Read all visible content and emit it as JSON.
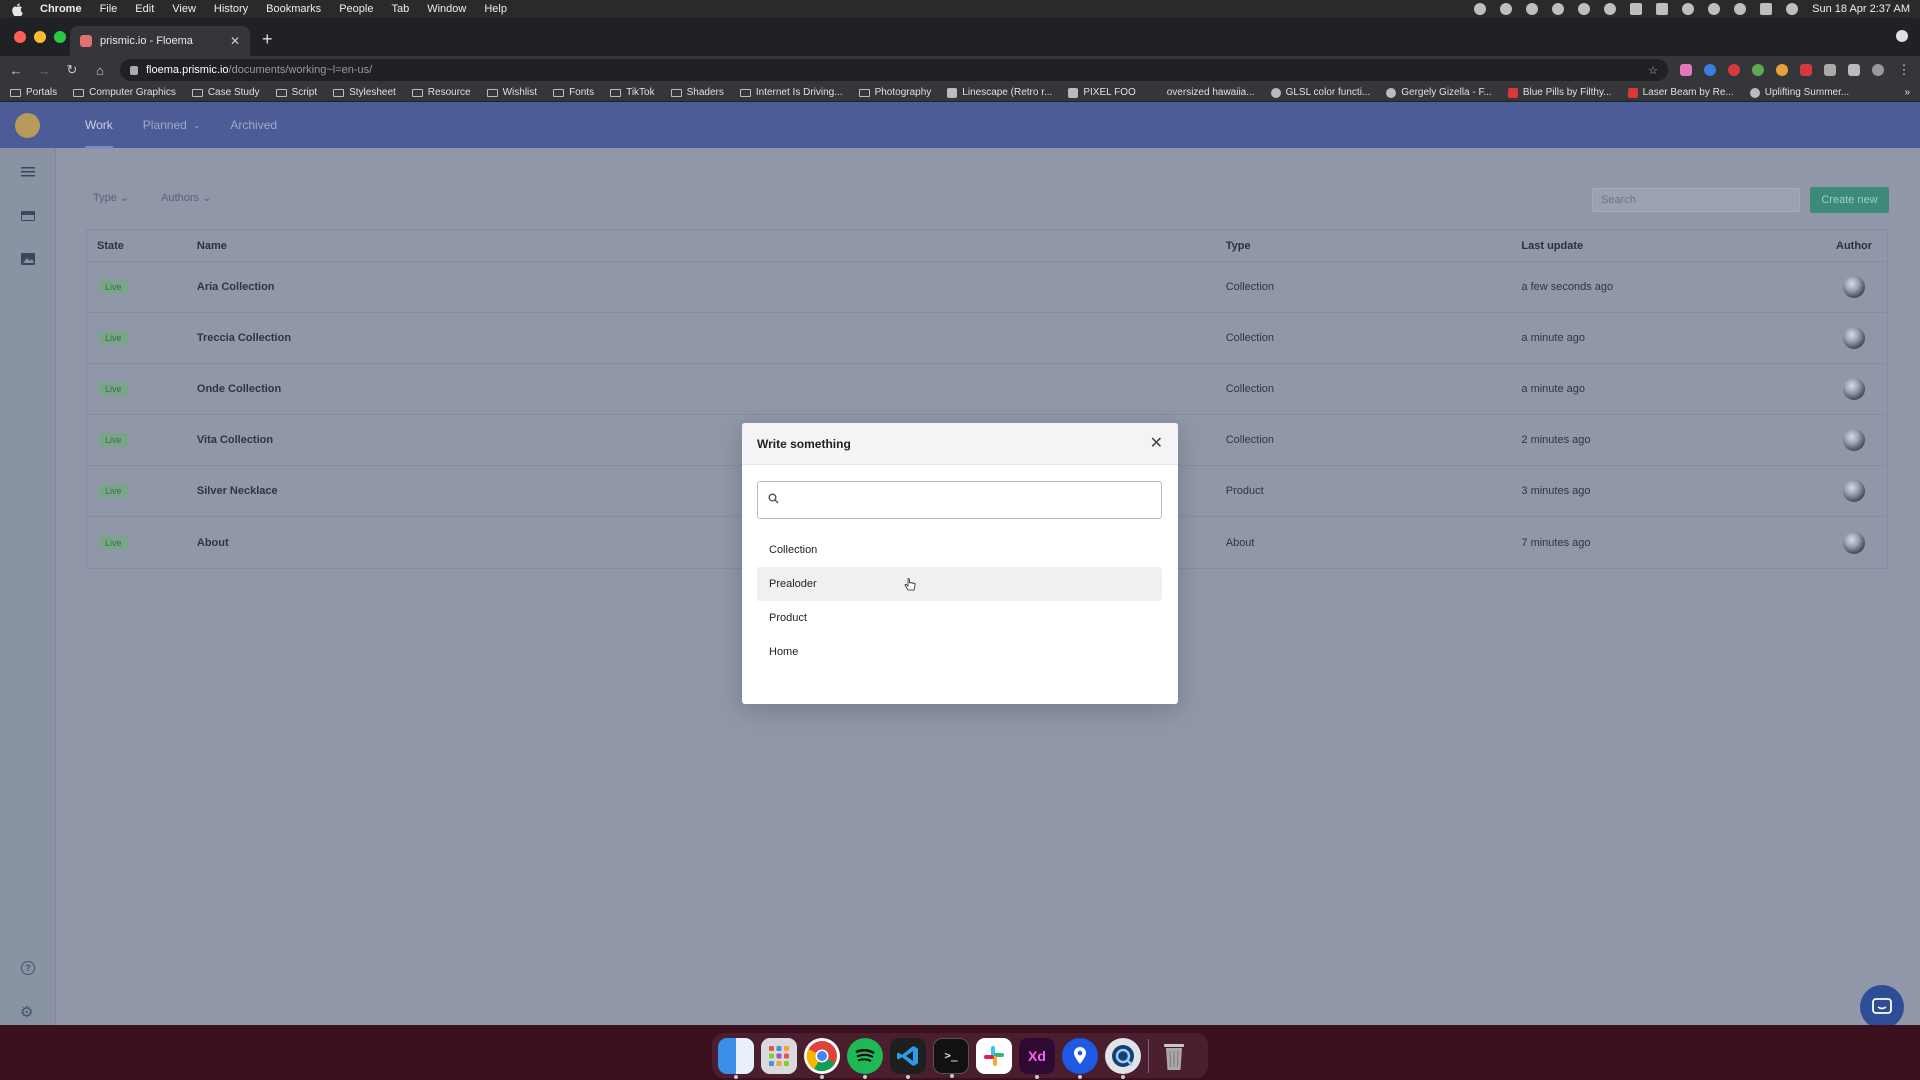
{
  "menubar": {
    "app_name": "Chrome",
    "items": [
      "File",
      "Edit",
      "View",
      "History",
      "Bookmarks",
      "People",
      "Tab",
      "Window",
      "Help"
    ],
    "clock": "Sun 18 Apr  2:37 AM"
  },
  "browser": {
    "tab_title": "prismic.io - Floema",
    "url_host": "floema.prismic.io",
    "url_path": "/documents/working~l=en-us/",
    "bookmarks": [
      {
        "label": "Portals",
        "icon": "folder-icon"
      },
      {
        "label": "Computer Graphics",
        "icon": "folder-icon"
      },
      {
        "label": "Case Study",
        "icon": "folder-icon"
      },
      {
        "label": "Script",
        "icon": "folder-icon"
      },
      {
        "label": "Stylesheet",
        "icon": "folder-icon"
      },
      {
        "label": "Resource",
        "icon": "folder-icon"
      },
      {
        "label": "Wishlist",
        "icon": "folder-icon"
      },
      {
        "label": "Fonts",
        "icon": "folder-icon"
      },
      {
        "label": "TikTok",
        "icon": "folder-icon"
      },
      {
        "label": "Shaders",
        "icon": "folder-icon"
      },
      {
        "label": "Internet Is Driving...",
        "icon": "folder-icon"
      },
      {
        "label": "Photography",
        "icon": "folder-icon"
      },
      {
        "label": "Linescape (Retro r...",
        "icon": "favicon"
      },
      {
        "label": "PIXEL FOO",
        "icon": "favicon"
      },
      {
        "label": "oversized hawaiia...",
        "icon": "favicon"
      },
      {
        "label": "GLSL color functi...",
        "icon": "github-icon"
      },
      {
        "label": "Gergely Gizella - F...",
        "icon": "favicon"
      },
      {
        "label": "Blue Pills by Filthy...",
        "icon": "favicon"
      },
      {
        "label": "Laser Beam by Re...",
        "icon": "favicon"
      },
      {
        "label": "Uplifting Summer...",
        "icon": "favicon"
      }
    ]
  },
  "app": {
    "nav_tabs": [
      {
        "label": "Work",
        "active": true
      },
      {
        "label": "Planned",
        "active": false,
        "dropdown": true
      },
      {
        "label": "Archived",
        "active": false
      }
    ],
    "filters": {
      "type_label": "Type",
      "authors_label": "Authors"
    },
    "search_placeholder": "Search",
    "create_label": "Create new",
    "table": {
      "headers": {
        "state": "State",
        "name": "Name",
        "type": "Type",
        "last_update": "Last update",
        "author": "Author"
      },
      "rows": [
        {
          "state": "Live",
          "name": "Aria Collection",
          "type": "Collection",
          "last_update": "a few seconds ago"
        },
        {
          "state": "Live",
          "name": "Treccia Collection",
          "type": "Collection",
          "last_update": "a minute ago"
        },
        {
          "state": "Live",
          "name": "Onde Collection",
          "type": "Collection",
          "last_update": "a minute ago"
        },
        {
          "state": "Live",
          "name": "Vita Collection",
          "type": "Collection",
          "last_update": "2 minutes ago"
        },
        {
          "state": "Live",
          "name": "Silver Necklace",
          "type": "Product",
          "last_update": "3 minutes ago"
        },
        {
          "state": "Live",
          "name": "About",
          "type": "About",
          "last_update": "7 minutes ago"
        }
      ]
    }
  },
  "modal": {
    "title": "Write something",
    "search_value": "",
    "options": [
      {
        "label": "Collection",
        "hover": false
      },
      {
        "label": "Prealoder",
        "hover": true
      },
      {
        "label": "Product",
        "hover": false
      },
      {
        "label": "Home",
        "hover": false
      }
    ]
  },
  "colors": {
    "header_bg": "#4c5c96",
    "create_button": "#3e8a78",
    "live_badge": "#7aa589",
    "overlay_tint": "#8f97a8"
  },
  "dock_apps": [
    "Finder",
    "Launchpad",
    "Chrome",
    "Spotify",
    "Visual Studio Code",
    "Terminal",
    "Slack",
    "Adobe XD",
    "Maps",
    "QuickTime",
    "Trash"
  ]
}
